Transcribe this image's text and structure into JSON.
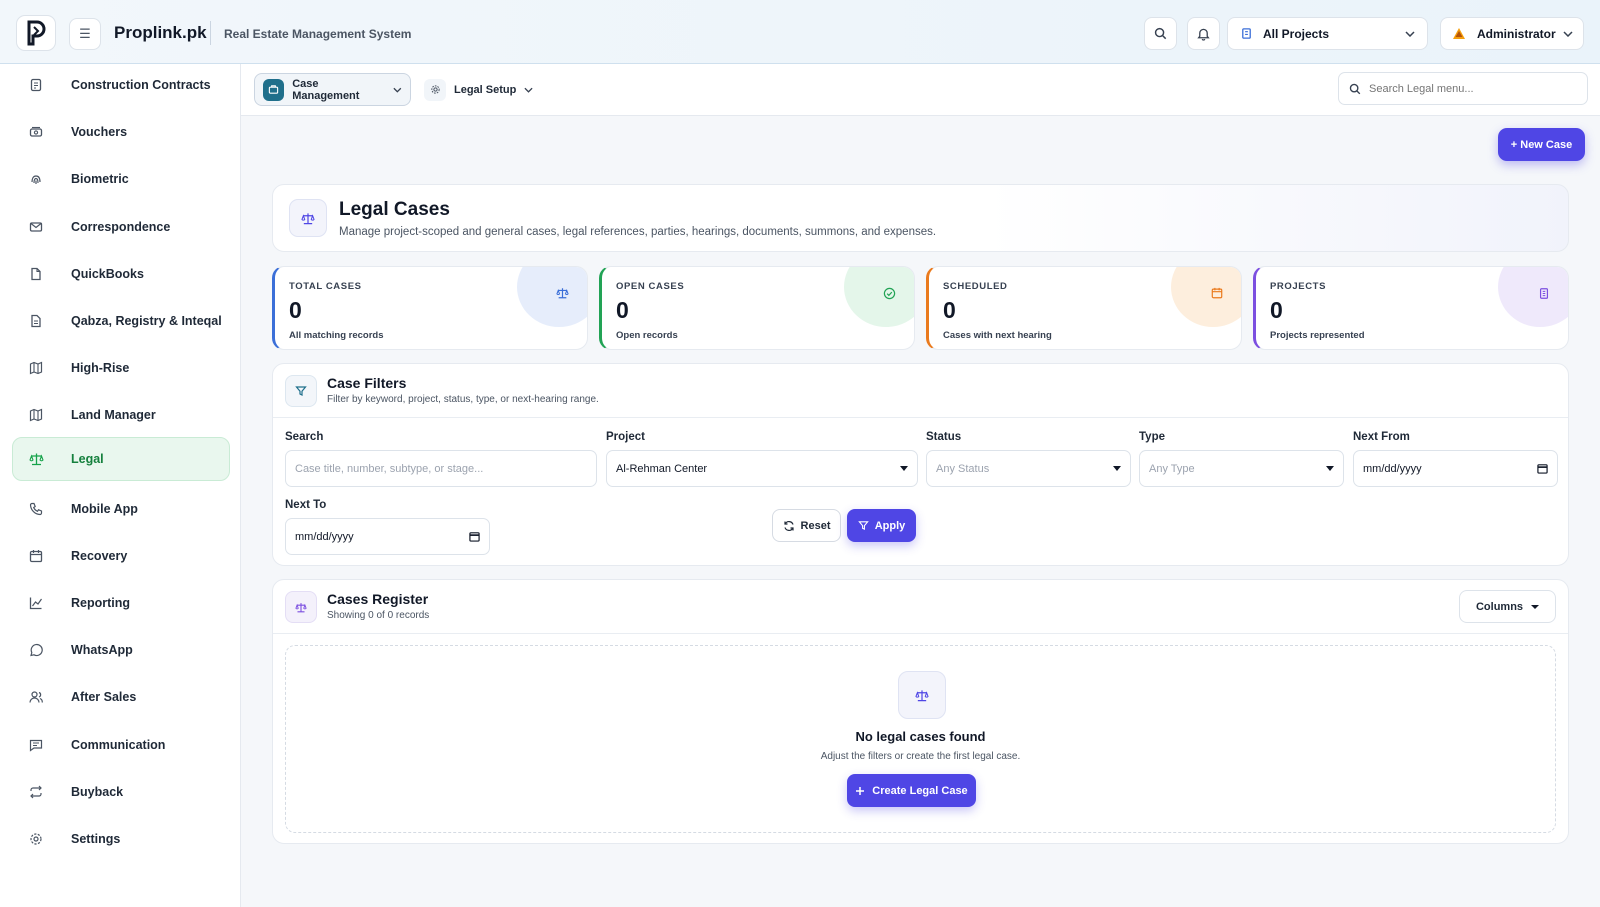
{
  "header": {
    "brand": "Proplink.pk",
    "subtitle": "Real Estate Management System",
    "project_selector": "All Projects",
    "user": "Administrator"
  },
  "sidebar": {
    "items": [
      {
        "label": "Construction Contracts",
        "icon": "contract-icon"
      },
      {
        "label": "Vouchers",
        "icon": "voucher-icon"
      },
      {
        "label": "Biometric",
        "icon": "fingerprint-icon"
      },
      {
        "label": "Correspondence",
        "icon": "mail-icon"
      },
      {
        "label": "QuickBooks",
        "icon": "file-icon"
      },
      {
        "label": "Qabza, Registry & Inteqal",
        "icon": "document-icon"
      },
      {
        "label": "High-Rise",
        "icon": "map-icon"
      },
      {
        "label": "Land Manager",
        "icon": "map-icon"
      },
      {
        "label": "Legal",
        "icon": "scale-icon",
        "active": true
      },
      {
        "label": "Mobile App",
        "icon": "phone-icon"
      },
      {
        "label": "Recovery",
        "icon": "calendar-icon"
      },
      {
        "label": "Reporting",
        "icon": "chart-icon"
      },
      {
        "label": "WhatsApp",
        "icon": "whatsapp-icon"
      },
      {
        "label": "After Sales",
        "icon": "users-icon"
      },
      {
        "label": "Communication",
        "icon": "chat-icon"
      },
      {
        "label": "Buyback",
        "icon": "repeat-icon"
      },
      {
        "label": "Settings",
        "icon": "gear-icon"
      }
    ]
  },
  "subnav": {
    "case_management": "Case Management",
    "legal_setup": "Legal Setup",
    "search_placeholder": "Search Legal menu..."
  },
  "new_case_label": "+ New Case",
  "hero": {
    "title": "Legal Cases",
    "description": "Manage project-scoped and general cases, legal references, parties, hearings, documents, summons, and expenses."
  },
  "stats": [
    {
      "label": "TOTAL CASES",
      "value": "0",
      "sub": "All matching records",
      "accent": "#3b6fd8",
      "blob": "#e6edfb"
    },
    {
      "label": "OPEN CASES",
      "value": "0",
      "sub": "Open records",
      "accent": "#22a355",
      "blob": "#e4f6ea"
    },
    {
      "label": "SCHEDULED",
      "value": "0",
      "sub": "Cases with next hearing",
      "accent": "#ea7a1d",
      "blob": "#fdeedd"
    },
    {
      "label": "PROJECTS",
      "value": "0",
      "sub": "Projects represented",
      "accent": "#7c4fe0",
      "blob": "#efe9fb"
    }
  ],
  "filters": {
    "title": "Case Filters",
    "subtitle": "Filter by keyword, project, status, type, or next-hearing range.",
    "search_label": "Search",
    "search_placeholder": "Case title, number, subtype, or stage...",
    "project_label": "Project",
    "project_value": "Al-Rehman Center",
    "status_label": "Status",
    "status_value": "Any Status",
    "type_label": "Type",
    "type_value": "Any Type",
    "next_from_label": "Next From",
    "next_from_value": "mm/dd/yyyy",
    "next_to_label": "Next To",
    "next_to_value": "mm/dd/yyyy",
    "reset_label": "Reset",
    "apply_label": "Apply"
  },
  "register": {
    "title": "Cases Register",
    "subtitle": "Showing 0 of 0 records",
    "columns_label": "Columns",
    "empty_title": "No legal cases found",
    "empty_subtitle": "Adjust the filters or create the first legal case.",
    "create_label": "Create Legal Case"
  },
  "colors": {
    "primary": "#4f46e5",
    "legal_active": "#15803d",
    "brand_teal": "#1f6f8b"
  }
}
